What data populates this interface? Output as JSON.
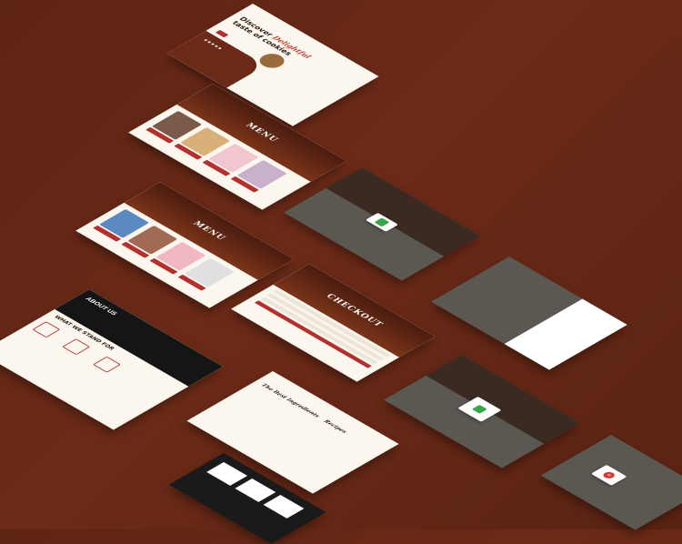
{
  "hero": {
    "headline_line1": "Discover",
    "headline_script": "Delightful",
    "headline_line2": "taste of cookies"
  },
  "menu_title": "MENU",
  "checkout_title": "CHECKOUT",
  "about_title": "ABOUT US",
  "stand_for_title": "WHAT WE STAND FOR",
  "recipes": {
    "left_script": "The Best Ingredients",
    "right_script": "Recipes"
  },
  "rating": "★★★★★",
  "colors": {
    "background": "#5e2414",
    "accent": "#b3302c",
    "cream": "#fbf7ee",
    "overlay": "#5b5852",
    "success": "#3aa64a",
    "error": "#d63b33"
  }
}
